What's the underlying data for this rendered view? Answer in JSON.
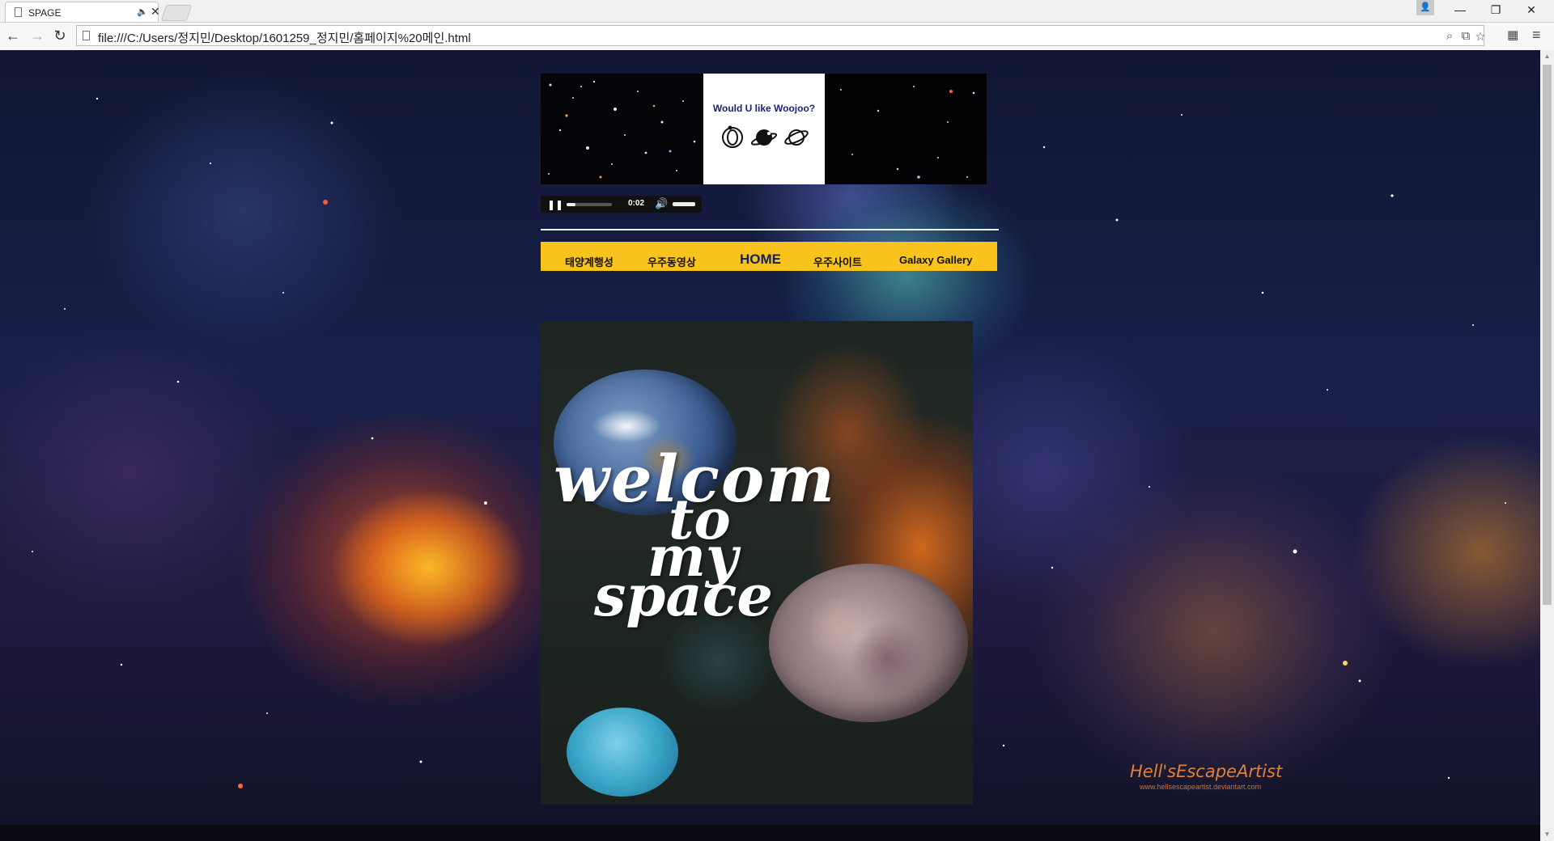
{
  "browser": {
    "tab_title": "SPAGE",
    "url": "file:///C:/Users/정지민/Desktop/1601259_정지민/홈페이지%20메인.html"
  },
  "banner": {
    "title": "Would U like Woojoo?",
    "icons": [
      "ringed-planet-icon",
      "saturn-icon",
      "orbit-planet-icon"
    ]
  },
  "audio": {
    "time": "0:02",
    "progress_fraction": 0.2,
    "volume_fraction": 1.0
  },
  "nav": {
    "items": [
      {
        "label": "태양계행성"
      },
      {
        "label": "우주동영상"
      },
      {
        "label": "HOME"
      },
      {
        "label": "우주사이트"
      },
      {
        "label": "Galaxy Gallery"
      }
    ]
  },
  "hero": {
    "lines": [
      "welcom",
      "to",
      "my",
      "space"
    ]
  },
  "watermark": {
    "signature": "Hell'sEscapeArtist",
    "url": "www.hellsescapeartist.deviantart.com"
  },
  "colors": {
    "nav_bg": "#f8c31d",
    "banner_title": "#1d2275"
  }
}
